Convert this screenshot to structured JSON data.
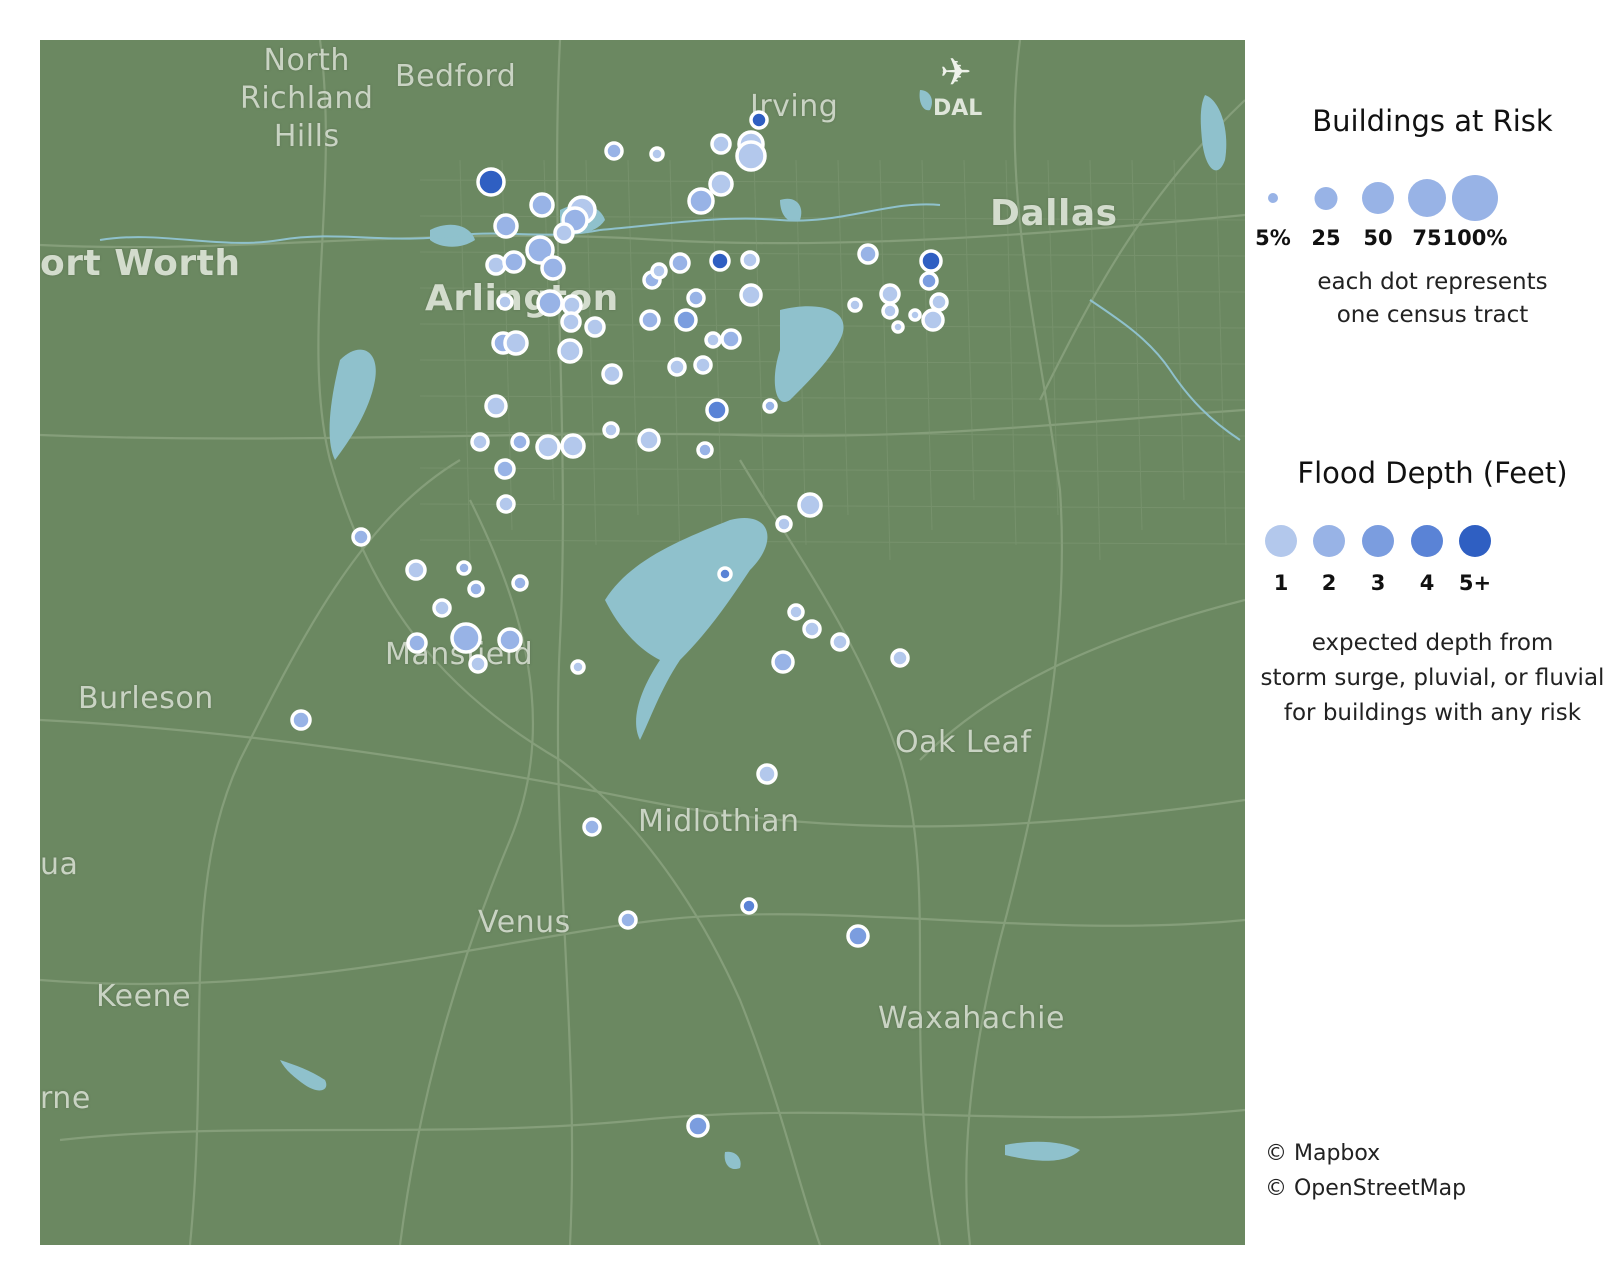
{
  "map": {
    "places": [
      {
        "name": "north-richland-hills-label",
        "lines": [
          "North",
          "Richland",
          "Hills"
        ]
      },
      {
        "name": "bedford-label",
        "text": "Bedford"
      },
      {
        "name": "irving-label",
        "text": "Irving"
      },
      {
        "name": "dallas-label",
        "text": "Dallas"
      },
      {
        "name": "fort-worth-label",
        "text": "ort Worth"
      },
      {
        "name": "arlington-label",
        "text": "Arlington"
      },
      {
        "name": "mansfield-label",
        "text": "Mansfield"
      },
      {
        "name": "burleson-label",
        "text": "Burleson"
      },
      {
        "name": "oak-leaf-label",
        "text": "Oak Leaf"
      },
      {
        "name": "midlothian-label",
        "text": "Midlothian"
      },
      {
        "name": "venus-label",
        "text": "Venus"
      },
      {
        "name": "keene-label",
        "text": "Keene"
      },
      {
        "name": "waxahachie-label",
        "text": "Waxahachie"
      },
      {
        "name": "cleburne-partial-label",
        "text": "rne"
      },
      {
        "name": "joshua-partial-label",
        "text": "ua"
      }
    ],
    "airport_code": "DAL",
    "airport_icon": "airplane-icon",
    "colors": {
      "land": "#6b8861",
      "water": "#8fc1cc",
      "road": "#8aa27f",
      "depth_1": "#b3c8ec",
      "depth_2": "#98b3e6",
      "depth_3": "#7b9ddf",
      "depth_4": "#5a83d6",
      "depth_5_plus": "#2f5fc2"
    }
  },
  "legend": {
    "size_title": "Buildings at Risk",
    "size_items": [
      {
        "label": "5%",
        "value": 5
      },
      {
        "label": "25",
        "value": 25
      },
      {
        "label": "50",
        "value": 50
      },
      {
        "label": "75",
        "value": 75
      },
      {
        "label": "100%",
        "value": 100
      }
    ],
    "size_note": [
      "each dot represents",
      "one census tract"
    ],
    "depth_title": "Flood Depth (Feet)",
    "depth_items": [
      {
        "label": "1",
        "color": "#b3c8ec"
      },
      {
        "label": "2",
        "color": "#98b3e6"
      },
      {
        "label": "3",
        "color": "#7b9ddf"
      },
      {
        "label": "4",
        "color": "#5a83d6"
      },
      {
        "label": "5+",
        "color": "#2f5fc2"
      }
    ],
    "depth_note": [
      "expected depth from",
      "storm surge, pluvial, or fluvial",
      "for buildings with any risk"
    ]
  },
  "attribution": [
    "© Mapbox",
    "© OpenStreetMap"
  ]
}
